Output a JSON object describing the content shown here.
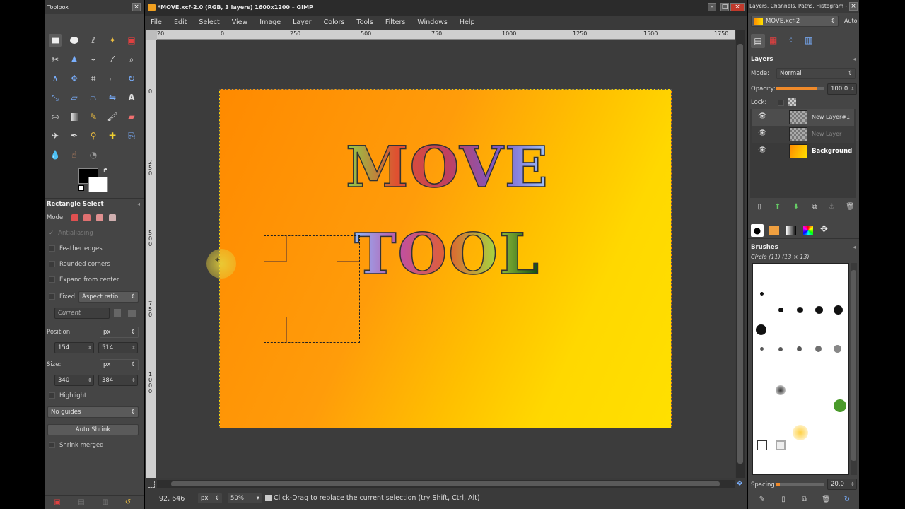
{
  "toolbox": {
    "title": "Toolbox",
    "tool_options_title": "Rectangle Select",
    "mode_label": "Mode:",
    "antialiasing": "Antialiasing",
    "feather_edges": "Feather edges",
    "rounded_corners": "Rounded corners",
    "expand_from_center": "Expand from center",
    "fixed_label": "Fixed:",
    "fixed_value": "Aspect ratio",
    "current_value": "Current",
    "position_label": "Position:",
    "position_unit": "px",
    "position_x": "154",
    "position_y": "514",
    "size_label": "Size:",
    "size_unit": "px",
    "size_w": "340",
    "size_h": "384",
    "highlight": "Highlight",
    "guides": "No guides",
    "auto_shrink": "Auto Shrink",
    "shrink_merged": "Shrink merged"
  },
  "image_window": {
    "title": "*MOVE.xcf-2.0 (RGB, 3 layers) 1600x1200 – GIMP",
    "menu": [
      "File",
      "Edit",
      "Select",
      "View",
      "Image",
      "Layer",
      "Colors",
      "Tools",
      "Filters",
      "Windows",
      "Help"
    ],
    "ruler_labels": [
      "20",
      "0",
      "250",
      "500",
      "750",
      "1000",
      "1250",
      "1500",
      "1750"
    ],
    "ruler_v_labels": [
      "0",
      "2\n5\n0",
      "5\n0\n0",
      "7\n5\n0",
      "1\n0\n0\n0"
    ],
    "canvas_text_line1": "MOVE",
    "canvas_text_line2": "TOOL",
    "status": {
      "coords": "92, 646",
      "unit": "px",
      "zoom": "50%",
      "message": "Click-Drag to replace the current selection (try Shift, Ctrl, Alt)"
    }
  },
  "dock": {
    "title": "Layers, Channels, Paths, Histogram - B...",
    "image_combo": "MOVE.xcf-2",
    "auto_label": "Auto",
    "layers_title": "Layers",
    "mode_label": "Mode:",
    "mode_value": "Normal",
    "opacity_label": "Opacity:",
    "opacity_value": "100.0",
    "lock_label": "Lock:",
    "layers": [
      {
        "name": "New Layer#1"
      },
      {
        "name": "New Layer"
      },
      {
        "name": "Background"
      }
    ],
    "brushes_title": "Brushes",
    "brush_name": "Circle (11) (13 × 13)",
    "spacing_label": "Spacing:",
    "spacing_value": "20.0"
  },
  "colors": {
    "bg_dark": "#454545",
    "canvas_gradient_a": "#ff8c00",
    "canvas_gradient_b": "#ffe000",
    "accent_orange": "#f08a2a"
  }
}
